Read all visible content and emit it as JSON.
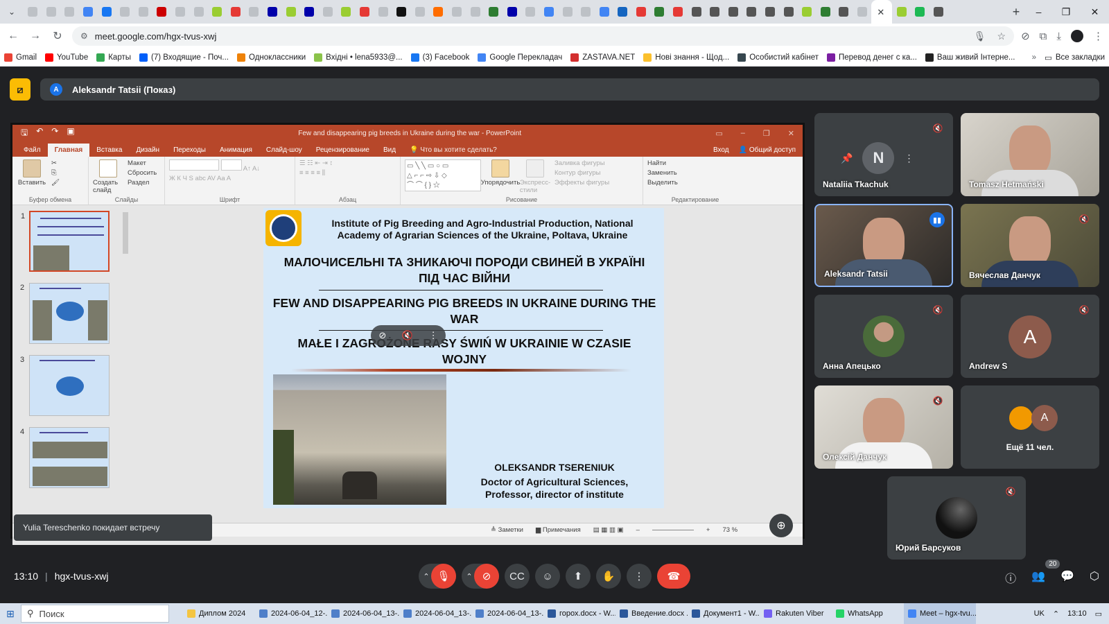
{
  "browser": {
    "url": "meet.google.com/hgx-tvus-xwj",
    "favicon_colors": [
      "#bdc1c6",
      "#bdc1c6",
      "#bdc1c6",
      "#4285f4",
      "#1877f2",
      "#bdc1c6",
      "#bdc1c6",
      "#c00",
      "#bdc1c6",
      "#bdc1c6",
      "#9acd32",
      "#e53935",
      "#bdc1c6",
      "#00a",
      "#9acd32",
      "#00a",
      "#bdc1c6",
      "#9acd32",
      "#e53935",
      "#bdc1c6",
      "#111",
      "#bdc1c6",
      "#ff6d00",
      "#bdc1c6",
      "#bdc1c6",
      "#2e7d32",
      "#00a",
      "#bdc1c6",
      "#4285f4",
      "#bdc1c6",
      "#bdc1c6",
      "#4285f4",
      "#1565c0",
      "#e53935",
      "#2e7d32",
      "#e53935",
      "#555",
      "#555",
      "#555",
      "#555",
      "#555",
      "#555",
      "#9acd32",
      "#2e7d32",
      "#555",
      "#bdc1c6",
      "#bdc1c6",
      "#9acd32",
      "#1db954",
      "#555"
    ]
  },
  "bookmarks": [
    {
      "label": "Gmail",
      "color": "#ea4335"
    },
    {
      "label": "YouTube",
      "color": "#ff0000"
    },
    {
      "label": "Карты",
      "color": "#34a853"
    },
    {
      "label": "(7) Входящие - Поч...",
      "color": "#005ff9"
    },
    {
      "label": "Одноклассники",
      "color": "#ee8208"
    },
    {
      "label": "Вхідні • lena5933@...",
      "color": "#8bc34a"
    },
    {
      "label": "(3) Facebook",
      "color": "#1877f2"
    },
    {
      "label": "Google Перекладач",
      "color": "#4285f4"
    },
    {
      "label": "ZASTAVA.NET",
      "color": "#d32f2f"
    },
    {
      "label": "Нові знання - Щод...",
      "color": "#fbc02d"
    },
    {
      "label": "Особистий кабінет",
      "color": "#37474f"
    },
    {
      "label": "Перевод денег с ка...",
      "color": "#7b1fa2"
    },
    {
      "label": "Ваш живий Інтерне...",
      "color": "#222"
    }
  ],
  "bookmarks_all": "Все закладки",
  "meet": {
    "presenter": "Aleksandr Tatsii (Показ)",
    "presenter_initial": "A",
    "time": "13:10",
    "code": "hgx-tvus-xwj",
    "toast": "Yulia Tereschenko покидает встречу",
    "participants_count": "20"
  },
  "ppt": {
    "window_title": "Few and disappearing pig breeds in Ukraine during the war - PowerPoint",
    "tabs": [
      "Файл",
      "Главная",
      "Вставка",
      "Дизайн",
      "Переходы",
      "Анимация",
      "Слайд-шоу",
      "Рецензирование",
      "Вид"
    ],
    "tell_me": "Что вы хотите сделать?",
    "sign_in": "Вход",
    "share": "Общий доступ",
    "ribbon": {
      "paste": "Вставить",
      "new_slide": "Создать слайд",
      "layout": "Макет",
      "reset": "Сбросить",
      "section": "Раздел",
      "arrange": "Упорядочить",
      "quick_styles": "Экспресс-стили",
      "fill": "Заливка фигуры",
      "outline": "Контур фигуры",
      "effects": "Эффекты фигуры",
      "find": "Найти",
      "replace": "Заменить",
      "select": "Выделить",
      "groups": [
        "Буфер обмена",
        "Слайды",
        "Шрифт",
        "Абзац",
        "Рисование",
        "Редактирование"
      ]
    },
    "thumb_numbers": [
      "1",
      "2",
      "3",
      "4"
    ],
    "status": {
      "notes": "Заметки",
      "comments": "Примечания",
      "zoom": "73 %"
    }
  },
  "slide": {
    "institute": "Institute of Pig Breeding and Agro-Industrial Production, National Academy of Agrarian Sciences of the Ukraine, Poltava, Ukraine",
    "title_ua": "МАЛОЧИСЕЛЬНІ ТА ЗНИКАЮЧІ ПОРОДИ СВИНЕЙ В УКРАЇНІ ПІД ЧАС ВІЙНИ",
    "title_en": "FEW AND DISAPPEARING PIG BREEDS IN UKRAINE DURING THE WAR",
    "title_pl": "MAŁE I ZAGROŻONE RASY ŚWIŃ W UKRAINIE W CZASIE WOJNY",
    "author": "OLEKSANDR TSERENIUK",
    "degree": "Doctor of Agricultural Sciences, Professor, director of institute"
  },
  "tiles": [
    {
      "name": "Nataliia Tkachuk"
    },
    {
      "name": "Tomasz Hetmański"
    },
    {
      "name": "Aleksandr Tatsii"
    },
    {
      "name": "Вячеслав Данчук"
    },
    {
      "name": "Анна Апецько"
    },
    {
      "name": "Andrew S",
      "initial": "A"
    },
    {
      "name": "Олексій Данчук"
    },
    {
      "name": "Ещё 11 чел.",
      "initial": "A"
    },
    {
      "name": "Юрий Барсуков"
    }
  ],
  "taskbar": {
    "search": "Поиск",
    "tasks": [
      {
        "label": "Диплом 2024",
        "color": "#f4c542"
      },
      {
        "label": "2024-06-04_12-...",
        "color": "#4f7fc9"
      },
      {
        "label": "2024-06-04_13-...",
        "color": "#4f7fc9"
      },
      {
        "label": "2024-06-04_13-...",
        "color": "#4f7fc9"
      },
      {
        "label": "2024-06-04_13-...",
        "color": "#4f7fc9"
      },
      {
        "label": "горох.docx - W...",
        "color": "#2b579a"
      },
      {
        "label": "Введение.docx ...",
        "color": "#2b579a"
      },
      {
        "label": "Документ1 - W...",
        "color": "#2b579a"
      },
      {
        "label": "Rakuten Viber",
        "color": "#7360f2"
      },
      {
        "label": "WhatsApp",
        "color": "#25d366"
      },
      {
        "label": "Meet – hgx-tvu...",
        "color": "#4285f4"
      }
    ],
    "lang": "UK",
    "clock": "13:10"
  }
}
